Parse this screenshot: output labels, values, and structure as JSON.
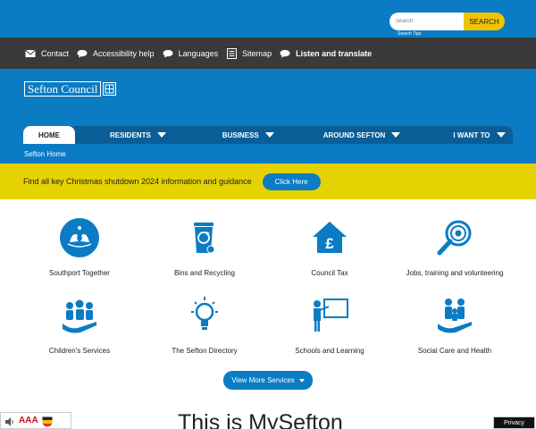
{
  "utility_bar": {
    "items": [
      {
        "label": "Contact",
        "icon": "envelope-icon"
      },
      {
        "label": "Accessibility help",
        "icon": "speech-bubble-icon"
      },
      {
        "label": "Languages",
        "icon": "speech-bubble-icon"
      },
      {
        "label": "Sitemap",
        "icon": "list-icon"
      },
      {
        "label": "Listen and translate",
        "icon": "speech-bubble-icon"
      }
    ]
  },
  "header": {
    "logo_text": "Sefton Council",
    "search_placeholder": "Search",
    "search_button": "SEARCH",
    "search_tips": "Search Tips"
  },
  "nav": {
    "items": [
      "HOME",
      "RESIDENTS",
      "BUSINESS",
      "AROUND SEFTON",
      "I WANT TO"
    ]
  },
  "breadcrumb": "Sefton Home",
  "alert": {
    "text": "Find all key Christmas shutdown 2024 information and guidance",
    "button": "Click Here"
  },
  "services": [
    {
      "label": "Southport Together",
      "icon": "southport-together-icon"
    },
    {
      "label": "Bins and Recycling",
      "icon": "recycling-bin-icon"
    },
    {
      "label": "Council Tax",
      "icon": "house-pound-icon"
    },
    {
      "label": "Jobs, training and volunteering",
      "icon": "magnifier-icon"
    },
    {
      "label": "Children's Services",
      "icon": "people-hand-icon"
    },
    {
      "label": "The Sefton Directory",
      "icon": "lightbulb-icon"
    },
    {
      "label": "Schools and Learning",
      "icon": "teacher-board-icon"
    },
    {
      "label": "Social Care and Health",
      "icon": "family-care-icon"
    }
  ],
  "more_services_button": "View More Services",
  "heading": "This is MySefton",
  "a11y": {
    "text_size_label": "AAA"
  },
  "privacy": "Privacy",
  "colors": {
    "brand_blue": "#0b7cc4",
    "nav_dark_blue": "#0a5e97",
    "alert_yellow": "#e5d200",
    "search_button_yellow": "#f0c400",
    "utility_bar": "#3a3a3a"
  }
}
